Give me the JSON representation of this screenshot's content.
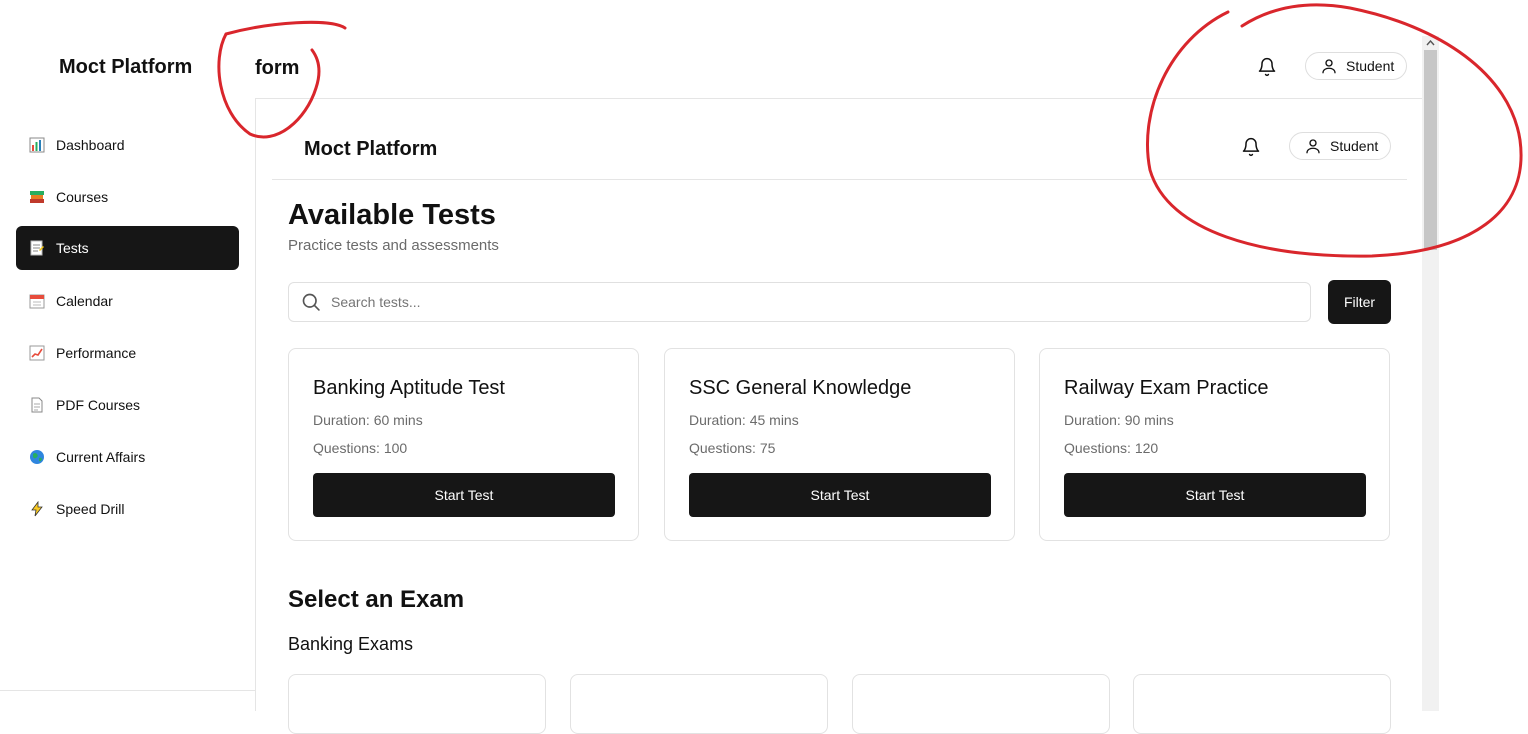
{
  "header": {
    "brand": "Moct Platform",
    "brand_overlap_fragment": "form",
    "user_label": "Student"
  },
  "inner_header": {
    "brand": "Moct Platform",
    "user_label": "Student"
  },
  "sidebar": {
    "items": [
      {
        "label": "Dashboard",
        "icon": "bar-chart-icon",
        "active": false
      },
      {
        "label": "Courses",
        "icon": "books-icon",
        "active": false
      },
      {
        "label": "Tests",
        "icon": "memo-icon",
        "active": true
      },
      {
        "label": "Calendar",
        "icon": "calendar-icon",
        "active": false
      },
      {
        "label": "Performance",
        "icon": "chart-increasing-icon",
        "active": false
      },
      {
        "label": "PDF Courses",
        "icon": "page-icon",
        "active": false
      },
      {
        "label": "Current Affairs",
        "icon": "globe-icon",
        "active": false
      },
      {
        "label": "Speed Drill",
        "icon": "lightning-icon",
        "active": false
      }
    ]
  },
  "main": {
    "title": "Available Tests",
    "subtitle": "Practice tests and assessments",
    "search": {
      "placeholder": "Search tests...",
      "value": ""
    },
    "filter_label": "Filter",
    "tests": [
      {
        "title": "Banking Aptitude Test",
        "duration": "Duration: 60 mins",
        "questions": "Questions: 100",
        "button": "Start Test"
      },
      {
        "title": "SSC General Knowledge",
        "duration": "Duration: 45 mins",
        "questions": "Questions: 75",
        "button": "Start Test"
      },
      {
        "title": "Railway Exam Practice",
        "duration": "Duration: 90 mins",
        "questions": "Questions: 120",
        "button": "Start Test"
      }
    ],
    "exam_section_title": "Select an Exam",
    "exam_group_title": "Banking Exams"
  },
  "colors": {
    "primary": "#161616",
    "border": "#e2e2e2",
    "muted_text": "#6b6b6b",
    "annotation": "#d9262c"
  }
}
